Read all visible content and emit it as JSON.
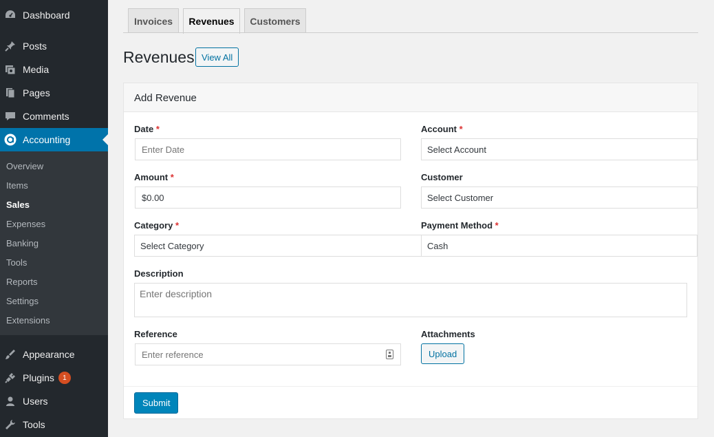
{
  "sidebar": {
    "top_items": [
      {
        "label": "Dashboard",
        "icon": "dashboard-icon"
      },
      {
        "label": "Posts",
        "icon": "pin-icon"
      },
      {
        "label": "Media",
        "icon": "media-icon"
      },
      {
        "label": "Pages",
        "icon": "pages-icon"
      },
      {
        "label": "Comments",
        "icon": "comments-icon"
      },
      {
        "label": "Accounting",
        "icon": "accounting-icon"
      }
    ],
    "sub_items": [
      "Overview",
      "Items",
      "Sales",
      "Expenses",
      "Banking",
      "Tools",
      "Reports",
      "Settings",
      "Extensions"
    ],
    "bottom_items": [
      {
        "label": "Appearance",
        "icon": "appearance-icon"
      },
      {
        "label": "Plugins",
        "icon": "plugins-icon",
        "badge": "1"
      },
      {
        "label": "Users",
        "icon": "users-icon"
      },
      {
        "label": "Tools",
        "icon": "tools-icon"
      }
    ]
  },
  "tabs": [
    "Invoices",
    "Revenues",
    "Customers"
  ],
  "page": {
    "title": "Revenues",
    "view_all": "View All"
  },
  "panel": {
    "title": "Add Revenue"
  },
  "form": {
    "date": {
      "label": "Date",
      "placeholder": "Enter Date"
    },
    "account": {
      "label": "Account",
      "value": "Select Account"
    },
    "amount": {
      "label": "Amount",
      "value": "$0.00"
    },
    "customer": {
      "label": "Customer",
      "value": "Select Customer"
    },
    "category": {
      "label": "Category",
      "value": "Select Category"
    },
    "payment_method": {
      "label": "Payment Method",
      "value": "Cash"
    },
    "description": {
      "label": "Description",
      "placeholder": "Enter description"
    },
    "reference": {
      "label": "Reference",
      "placeholder": "Enter reference"
    },
    "attachments": {
      "label": "Attachments",
      "button": "Upload"
    },
    "required_mark": "*",
    "submit": "Submit"
  },
  "colors": {
    "sidebar": "#23282d",
    "submenu": "#32373c",
    "accent": "#0073aa",
    "required": "#dc3232",
    "badge": "#d54e21"
  }
}
